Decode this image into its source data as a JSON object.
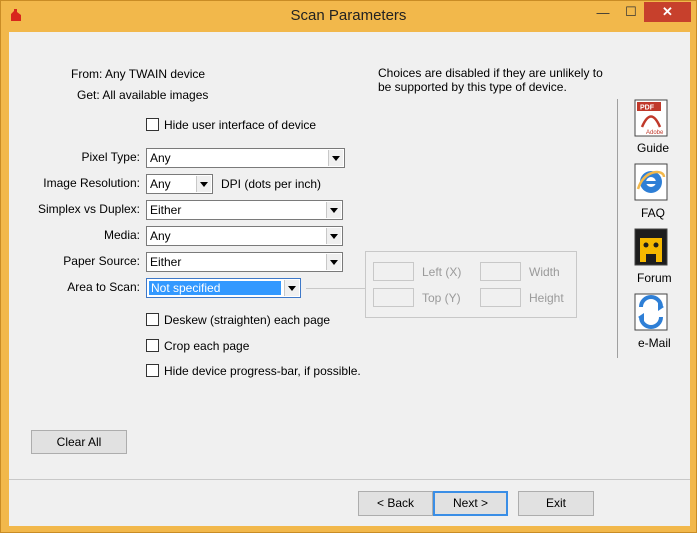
{
  "window": {
    "title": "Scan Parameters",
    "buttons": {
      "minimize": "—",
      "maximize": "☐",
      "close": "✕"
    }
  },
  "info": {
    "from": "From:  Any TWAIN device",
    "get": "Get:  All available images",
    "note_line1": "Choices are disabled if they are unlikely to",
    "note_line2": "be supported by this type of device."
  },
  "hide_ui": {
    "label": "Hide user interface of device",
    "checked": false
  },
  "form": {
    "pixel_type": {
      "label": "Pixel Type:",
      "value": "Any"
    },
    "resolution": {
      "label": "Image Resolution:",
      "value": "Any",
      "unit": "DPI (dots per inch)"
    },
    "duplex": {
      "label": "Simplex vs Duplex:",
      "value": "Either"
    },
    "media": {
      "label": "Media:",
      "value": "Any"
    },
    "paper_source": {
      "label": "Paper Source:",
      "value": "Either"
    },
    "area": {
      "label": "Area to Scan:",
      "value": "Not specified"
    }
  },
  "area_box": {
    "left": "Left (X)",
    "top": "Top (Y)",
    "width": "Width",
    "height": "Height"
  },
  "options": {
    "deskew": {
      "label": "Deskew (straighten) each page",
      "checked": false
    },
    "crop": {
      "label": "Crop each page",
      "checked": false
    },
    "hide_progress": {
      "label": "Hide device progress-bar, if possible.",
      "checked": false
    }
  },
  "sidebar": {
    "items": [
      {
        "label": "Guide",
        "icon": "pdf-icon"
      },
      {
        "label": "FAQ",
        "icon": "internet-explorer-icon"
      },
      {
        "label": "Forum",
        "icon": "forum-icon"
      },
      {
        "label": "e-Mail",
        "icon": "email-icon"
      }
    ],
    "pdf_badge": "PDF",
    "pdf_brand": "Adobe"
  },
  "buttons": {
    "clear_all": "Clear All",
    "back": "< Back",
    "next": "Next >",
    "exit": "Exit"
  },
  "colors": {
    "titlebar": "#f2b84b",
    "close": "#c7402c",
    "selection": "#3399ff",
    "default_button_border": "#3a8ee6"
  }
}
